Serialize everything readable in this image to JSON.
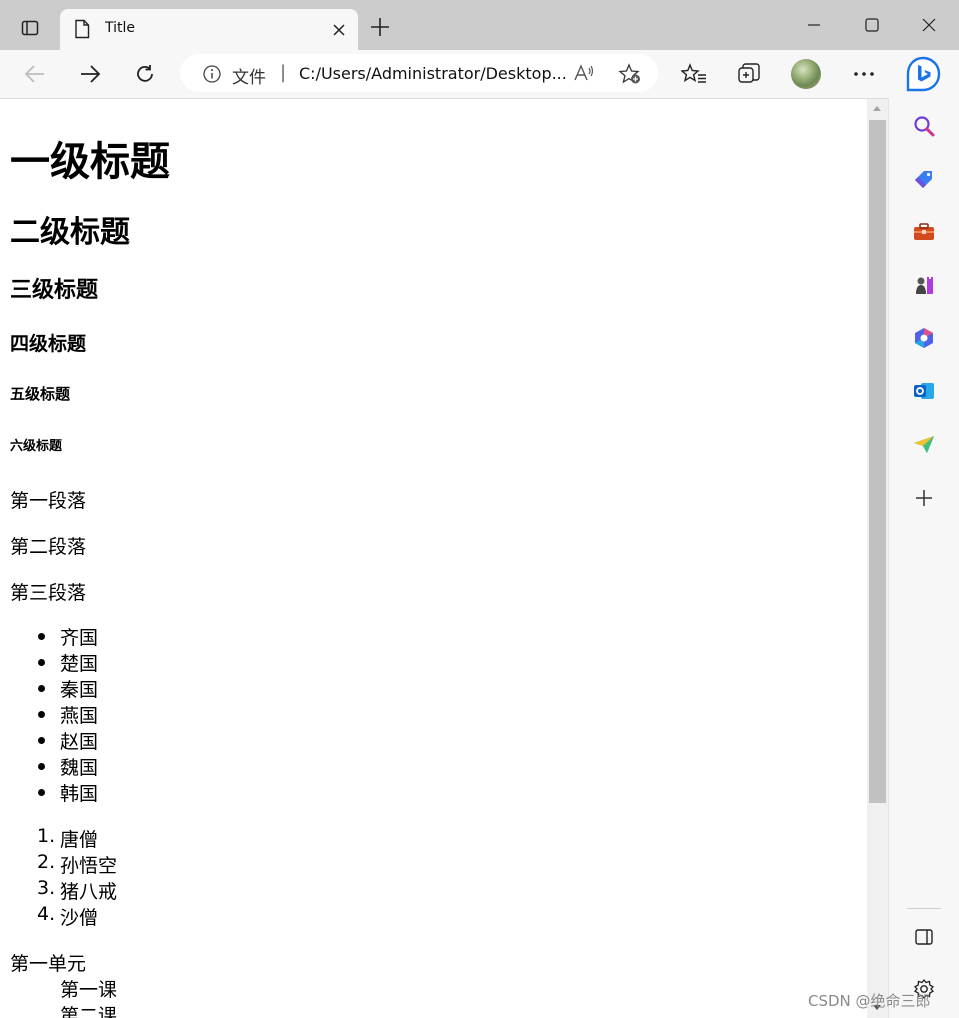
{
  "browser": {
    "tab_title": "Title",
    "address": {
      "scheme_label": "文件",
      "separator": "|",
      "url": "C:/Users/Administrator/Desktop..."
    }
  },
  "icons": {
    "titlebar": [
      "tab-actions-icon",
      "file-icon",
      "close-icon",
      "new-tab-icon",
      "minimize-icon",
      "maximize-icon",
      "window-close-icon"
    ],
    "toolbar": [
      "back-icon",
      "forward-icon",
      "refresh-icon",
      "info-icon",
      "read-aloud-icon",
      "add-favorite-icon",
      "favorites-icon",
      "collections-icon",
      "avatar",
      "more-icon",
      "bing-icon"
    ],
    "sidebar": [
      "search-icon",
      "shopping-tag-icon",
      "tools-icon",
      "games-icon",
      "office-icon",
      "outlook-icon",
      "send-icon",
      "add-icon",
      "sidebar-toggle-icon",
      "settings-icon"
    ]
  },
  "page": {
    "h1": "一级标题",
    "h2": "二级标题",
    "h3": "三级标题",
    "h4": "四级标题",
    "h5": "五级标题",
    "h6": "六级标题",
    "paragraphs": [
      "第一段落",
      "第二段落",
      "第三段落"
    ],
    "unordered_list": [
      "齐国",
      "楚国",
      "秦国",
      "燕国",
      "赵国",
      "魏国",
      "韩国"
    ],
    "ordered_list": [
      "唐僧",
      "孙悟空",
      "猪八戒",
      "沙僧"
    ],
    "ordered_markers": [
      "1.",
      "2.",
      "3.",
      "4."
    ],
    "definition_list": {
      "term": "第一单元",
      "descriptions": [
        "第一课",
        "第二课"
      ]
    }
  },
  "watermark": "CSDN @绝命三郎",
  "colors": {
    "titlebar": "#cccccc",
    "toolbar": "#f7f7f7",
    "bing_blue": "#1a73e8"
  }
}
